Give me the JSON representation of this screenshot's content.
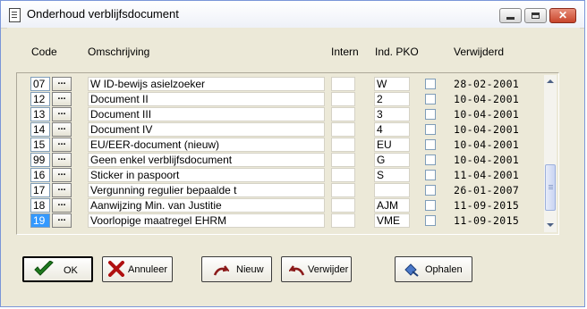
{
  "window": {
    "title": "Onderhoud verblijfsdocument",
    "controls": [
      "minimize",
      "maximize",
      "close"
    ]
  },
  "headers": {
    "code": "Code",
    "omschrijving": "Omschrijving",
    "intern": "Intern",
    "ind_pko": "Ind. PKO",
    "verwijderd": "Verwijderd"
  },
  "lookup_button_label": "...",
  "rows": [
    {
      "code": "07",
      "omschrijving": "W ID-bewijs asielzoeker",
      "intern": "",
      "ind": "W",
      "pko": false,
      "verwijderd": "28-02-2001"
    },
    {
      "code": "12",
      "omschrijving": "Document II",
      "intern": "",
      "ind": "2",
      "pko": false,
      "verwijderd": "10-04-2001"
    },
    {
      "code": "13",
      "omschrijving": "Document III",
      "intern": "",
      "ind": "3",
      "pko": false,
      "verwijderd": "10-04-2001"
    },
    {
      "code": "14",
      "omschrijving": "Document IV",
      "intern": "",
      "ind": "4",
      "pko": false,
      "verwijderd": "10-04-2001"
    },
    {
      "code": "15",
      "omschrijving": "EU/EER-document (nieuw)",
      "intern": "",
      "ind": "EU",
      "pko": false,
      "verwijderd": "10-04-2001"
    },
    {
      "code": "99",
      "omschrijving": "Geen enkel verblijfsdocument",
      "intern": "",
      "ind": "G",
      "pko": false,
      "verwijderd": "10-04-2001"
    },
    {
      "code": "16",
      "omschrijving": "Sticker in paspoort",
      "intern": "",
      "ind": "S",
      "pko": false,
      "verwijderd": "11-04-2001"
    },
    {
      "code": "17",
      "omschrijving": "Vergunning regulier bepaalde t",
      "intern": "",
      "ind": "",
      "pko": false,
      "verwijderd": "26-01-2007"
    },
    {
      "code": "18",
      "omschrijving": "Aanwijzing Min. van Justitie",
      "intern": "",
      "ind": "AJM",
      "pko": false,
      "verwijderd": "11-09-2015"
    },
    {
      "code": "19",
      "omschrijving": "Voorlopige maatregel EHRM",
      "intern": "",
      "ind": "VME",
      "pko": false,
      "verwijderd": "11-09-2015",
      "selected": true
    }
  ],
  "buttons": {
    "ok": "OK",
    "annuleer": "Annuleer",
    "nieuw": "Nieuw",
    "verwijder": "Verwijder",
    "ophalen": "Ophalen"
  },
  "icons": {
    "ok": "checkmark-icon",
    "annuleer": "red-x-icon",
    "nieuw": "new-record-icon",
    "verwijder": "undo-delete-icon",
    "ophalen": "fetch-icon"
  },
  "colors": {
    "selection": "#3399ff",
    "titlebar": "#eef1f8",
    "close_button": "#c8452b"
  }
}
